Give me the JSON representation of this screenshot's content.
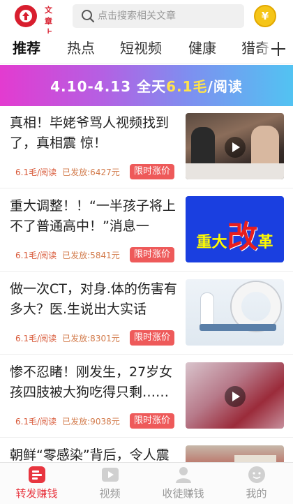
{
  "header": {
    "logo_text": "文章上传",
    "search_placeholder": "点击搜索相关文章",
    "coin_symbol": "¥"
  },
  "tabs": [
    {
      "label": "推荐",
      "active": true
    },
    {
      "label": "热点",
      "active": false
    },
    {
      "label": "短视频",
      "active": false
    },
    {
      "label": "健康",
      "active": false
    },
    {
      "label": "猎奇",
      "active": false
    }
  ],
  "banner": {
    "prefix": "4.10-4.13 全天",
    "highlight": "6.1毛",
    "suffix": "/阅读"
  },
  "articles": [
    {
      "title": "真相！毕姥爷骂人视频找到了，真相震 惊！",
      "rate": "6.1毛/阅读",
      "paid": "已发放:6427元",
      "promo": "限时涨价",
      "thumb": "dinner-scene-video",
      "video": true
    },
    {
      "title": "重大调整！！“一半孩子将上不了普通高中！”消息一出……",
      "rate": "6.1毛/阅读",
      "paid": "已发放:5841元",
      "promo": "限时涨价",
      "thumb": "reform-graphic",
      "thumb_text_small": "重大",
      "thumb_text_big": "改",
      "thumb_text_end": "革",
      "video": false
    },
    {
      "title": "做一次CT，对身.体的伤害有多大？医.生说出大实话",
      "rate": "6.1毛/阅读",
      "paid": "已发放:8301元",
      "promo": "限时涨价",
      "thumb": "ct-scanner-photo",
      "video": false
    },
    {
      "title": "惨不忍睹！刚发生，27岁女孩四肢被大狗吃得只剩……",
      "rate": "6.1毛/阅读",
      "paid": "已发放:9038元",
      "promo": "限时涨价",
      "thumb": "injury-video",
      "video": true
    },
    {
      "title": "朝鲜“零感染”背后，令人震惊",
      "thumb": "building-photo",
      "video": false
    }
  ],
  "bottom_nav": [
    {
      "label": "转发赚钱",
      "icon": "share-earn-icon",
      "active": true
    },
    {
      "label": "视频",
      "icon": "video-icon",
      "active": false
    },
    {
      "label": "收徒赚钱",
      "icon": "user-icon",
      "active": false
    },
    {
      "label": "我的",
      "icon": "profile-icon",
      "active": false
    }
  ],
  "colors": {
    "brand_red": "#d81e2e",
    "accent_red": "#e8353f",
    "promo_red": "#ee5a5a",
    "coin_gold": "#f5c518",
    "banner_gradient_start": "#e33bd0",
    "banner_gradient_end": "#52c3f2",
    "banner_highlight": "#ffe34b"
  }
}
